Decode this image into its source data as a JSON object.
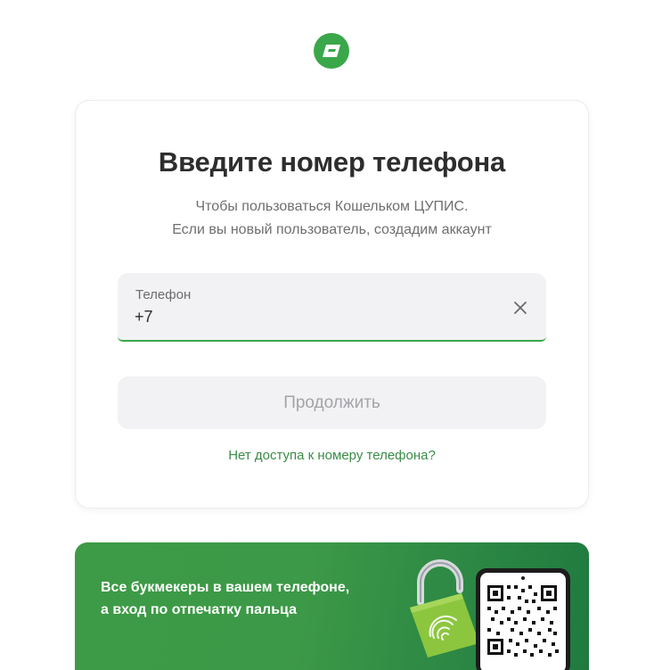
{
  "header": {
    "logo_icon": "wallet-logo-icon",
    "brand_color": "#3aa84a"
  },
  "card": {
    "title": "Введите номер телефона",
    "subtitle_line1": "Чтобы пользоваться Кошельком ЦУПИС.",
    "subtitle_line2": "Если вы новый пользователь, создадим аккаунт",
    "phone_field": {
      "label": "Телефон",
      "value": "+7",
      "clear_icon": "close-icon"
    },
    "continue_label": "Продолжить",
    "no_access_link": "Нет доступа к номеру телефона?"
  },
  "banner": {
    "line1": "Все букмекеры в вашем телефоне,",
    "line2": "а вход по отпечатку пальца",
    "art_icons": [
      "fingerprint-lock-icon",
      "qr-code-phone-icon"
    ]
  }
}
